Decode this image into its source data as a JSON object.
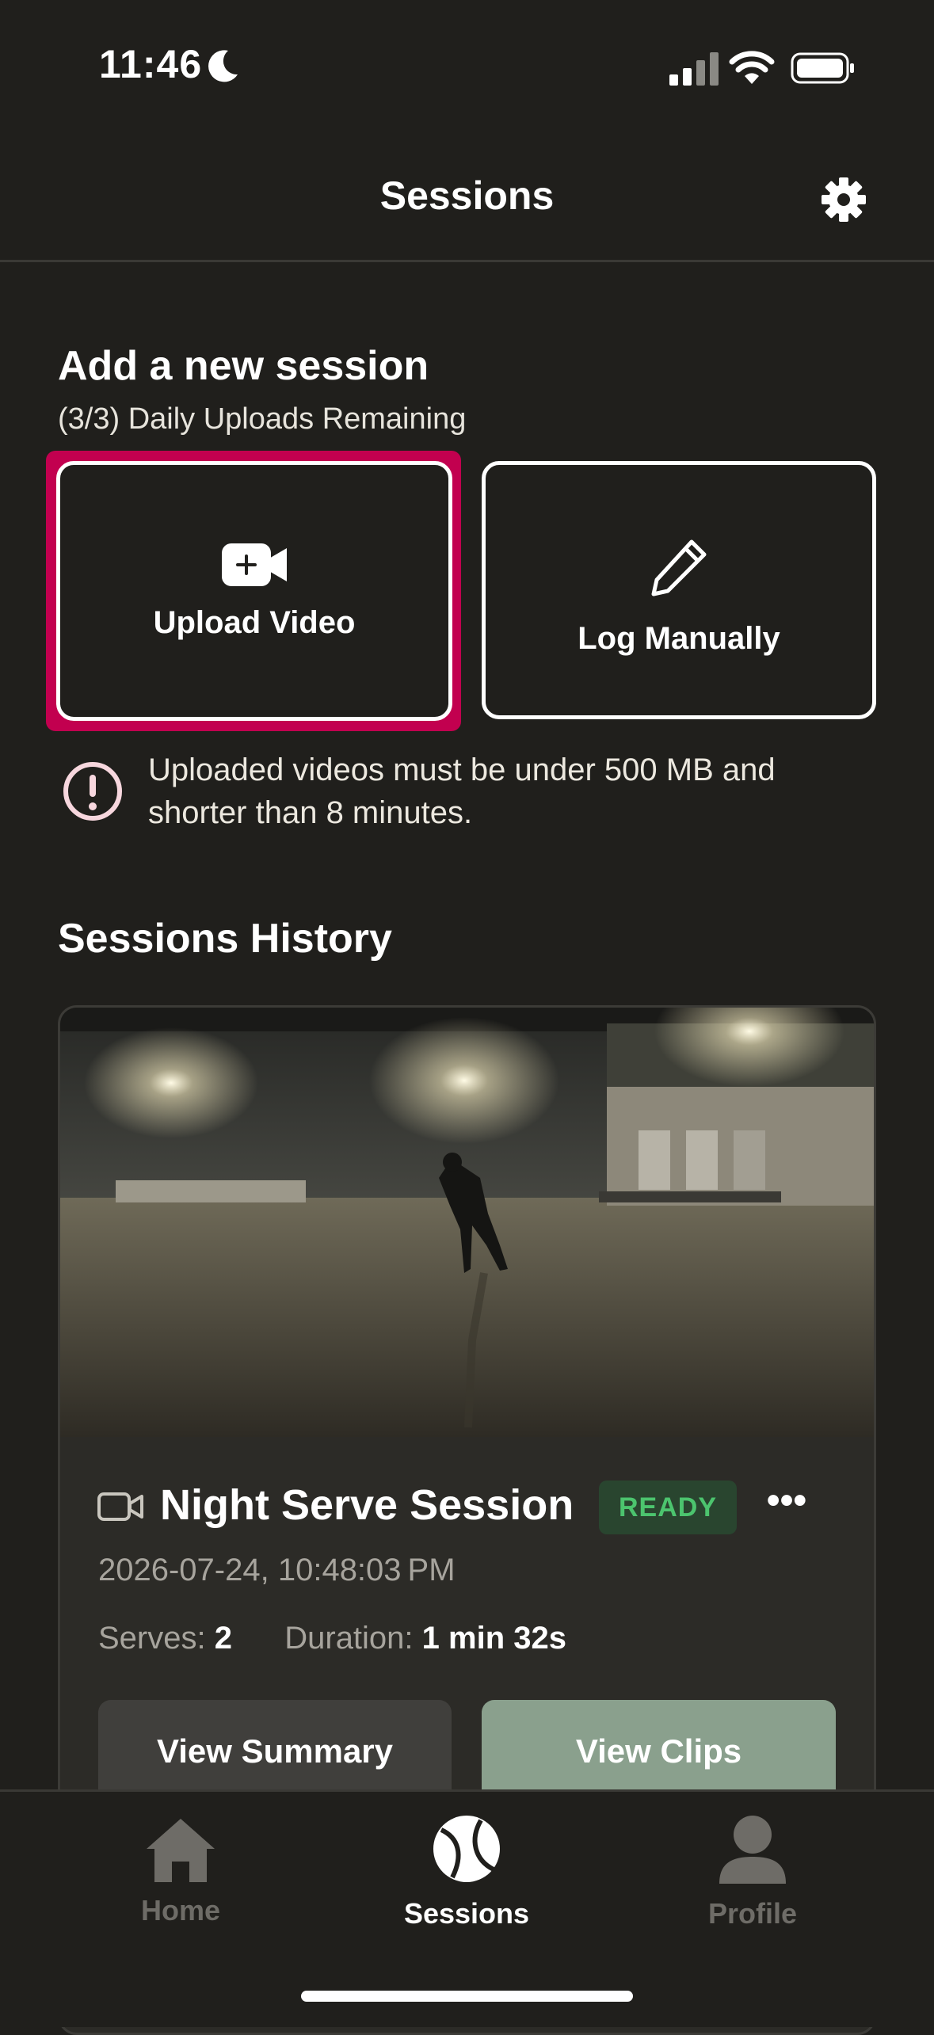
{
  "status_bar": {
    "time": "11:46"
  },
  "header": {
    "title": "Sessions"
  },
  "add_session": {
    "title": "Add a new session",
    "uploads_remaining": "(3/3) Daily Uploads Remaining",
    "upload_label": "Upload Video",
    "log_label": "Log Manually",
    "notice": "Uploaded videos must be under 500 MB and shorter than 8 minutes."
  },
  "history": {
    "title": "Sessions History",
    "session": {
      "name": "Night Serve Session",
      "status": "READY",
      "datetime": "2026-07-24, 10:48:03 PM",
      "serves_label": "Serves:",
      "serves_value": "2",
      "duration_label": "Duration:",
      "duration_value": "1 min 32s",
      "summary_button": "View Summary",
      "clips_button": "View Clips"
    }
  },
  "tabs": [
    {
      "label": "Home",
      "icon": "home-icon",
      "active": false
    },
    {
      "label": "Sessions",
      "icon": "tennis-ball-icon",
      "active": true
    },
    {
      "label": "Profile",
      "icon": "person-icon",
      "active": false
    }
  ],
  "colors": {
    "background": "#201f1c",
    "highlight": "#c2004f",
    "ready_badge": "#4cc46e",
    "clips_button": "#8aa08d",
    "inactive_tab": "#6e6c67"
  }
}
